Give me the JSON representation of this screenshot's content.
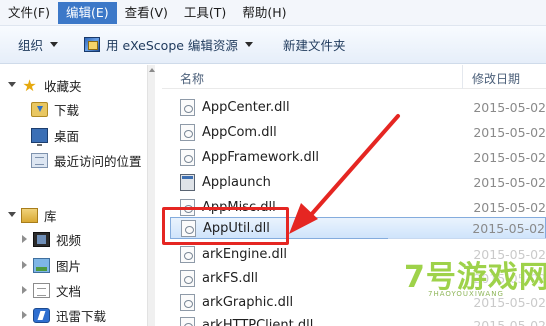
{
  "menu": [
    {
      "label": "文件(F)",
      "active": false
    },
    {
      "label": "编辑(E)",
      "active": true
    },
    {
      "label": "查看(V)",
      "active": false
    },
    {
      "label": "工具(T)",
      "active": false
    },
    {
      "label": "帮助(H)",
      "active": false
    }
  ],
  "toolbar": {
    "organize": "组织",
    "open_with": "用 eXeScope 编辑资源",
    "new_folder": "新建文件夹"
  },
  "nav": {
    "favorites": "收藏夹",
    "downloads": "下载",
    "desktop": "桌面",
    "recent": "最近访问的位置",
    "libraries": "库",
    "videos": "视频",
    "pictures": "图片",
    "documents": "文档",
    "thunder": "迅雷下载"
  },
  "columns": {
    "name": "名称",
    "date": "修改日期"
  },
  "files": [
    {
      "name": "AppCenter.dll",
      "date": "2015-05-02",
      "type": "dll"
    },
    {
      "name": "AppCom.dll",
      "date": "2015-05-02",
      "type": "dll"
    },
    {
      "name": "AppFramework.dll",
      "date": "2015-05-02",
      "type": "dll"
    },
    {
      "name": "Applaunch",
      "date": "2015-05-02",
      "type": "app"
    },
    {
      "name": "AppMisc.dll",
      "date": "2015-05-02",
      "type": "dll"
    },
    {
      "name": "AppUtil.dll",
      "date": "2015-05-02",
      "type": "dll",
      "selected": true
    },
    {
      "name": "arkEngine.dll",
      "date": "2015-05-02",
      "type": "dll"
    },
    {
      "name": "arkFS.dll",
      "date": "2015-05-02",
      "type": "dll"
    },
    {
      "name": "arkGraphic.dll",
      "date": "2015-05-02",
      "type": "dll"
    },
    {
      "name": "arkHTTPClient.dll",
      "date": "2015-05-02",
      "type": "dll"
    }
  ],
  "colors": {
    "highlight": "#e52622",
    "menu_active": "#3c78c8",
    "selection": "#cfe4fb"
  },
  "watermark": {
    "main": "7号游戏网",
    "sub": "7HAOYOUXIWANG"
  }
}
